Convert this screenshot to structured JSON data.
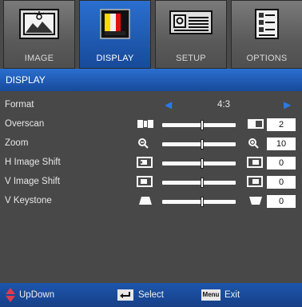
{
  "tabs": [
    {
      "label": "IMAGE",
      "icon": "image-icon"
    },
    {
      "label": "DISPLAY",
      "icon": "display-icon"
    },
    {
      "label": "SETUP",
      "icon": "projector-icon"
    },
    {
      "label": "OPTIONS",
      "icon": "options-icon"
    }
  ],
  "active_tab": "DISPLAY",
  "header": {
    "title": "DISPLAY"
  },
  "rows": [
    {
      "label": "Format",
      "value": "4:3"
    },
    {
      "label": "Overscan",
      "value": "2",
      "level": 0.55
    },
    {
      "label": "Zoom",
      "value": "10",
      "level": 0.55
    },
    {
      "label": "H Image Shift",
      "value": "0",
      "level": 0.55
    },
    {
      "label": "V Image Shift",
      "value": "0",
      "level": 0.55
    },
    {
      "label": "V Keystone",
      "value": "0",
      "level": 0.55
    }
  ],
  "footer": {
    "updown": "UpDown",
    "select": "Select",
    "menu_key": "Menu",
    "exit": "Exit"
  },
  "colors": {
    "accent": "#1f5fbe",
    "arrow": "#2a7ae8",
    "updown_icon": "#e23a4a"
  }
}
